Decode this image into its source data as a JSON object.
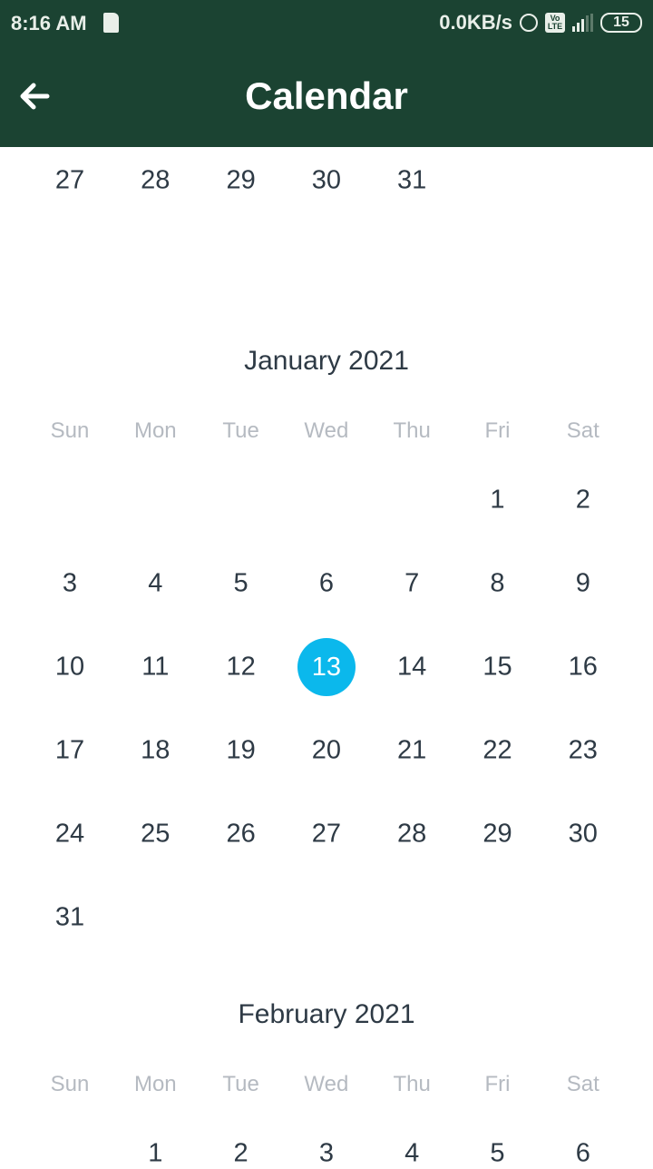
{
  "status_bar": {
    "time": "8:16 AM",
    "speed": "0.0KB/s",
    "network": "4G",
    "volte": "Vo LTE",
    "battery": "15"
  },
  "app_bar": {
    "title": "Calendar",
    "back_icon": "arrow-left-icon"
  },
  "colors": {
    "app_bar": "#1b4332",
    "selected": "#0bb8ec",
    "day_text": "#2e3a45",
    "weekday_text": "#b5bac1"
  },
  "selected_date": "January 13, 2021",
  "previous_month_tail": {
    "weeks": [
      [
        27,
        28,
        29,
        30,
        31,
        null,
        null
      ]
    ]
  },
  "months": [
    {
      "title": "January 2021",
      "weekdays": [
        "Sun",
        "Mon",
        "Tue",
        "Wed",
        "Thu",
        "Fri",
        "Sat"
      ],
      "selected_day": 13,
      "weeks": [
        [
          null,
          null,
          null,
          null,
          null,
          1,
          2
        ],
        [
          3,
          4,
          5,
          6,
          7,
          8,
          9
        ],
        [
          10,
          11,
          12,
          13,
          14,
          15,
          16
        ],
        [
          17,
          18,
          19,
          20,
          21,
          22,
          23
        ],
        [
          24,
          25,
          26,
          27,
          28,
          29,
          30
        ],
        [
          31,
          null,
          null,
          null,
          null,
          null,
          null
        ]
      ]
    },
    {
      "title": "February 2021",
      "weekdays": [
        "Sun",
        "Mon",
        "Tue",
        "Wed",
        "Thu",
        "Fri",
        "Sat"
      ],
      "weeks": [
        [
          null,
          1,
          2,
          3,
          4,
          5,
          6
        ]
      ]
    }
  ]
}
